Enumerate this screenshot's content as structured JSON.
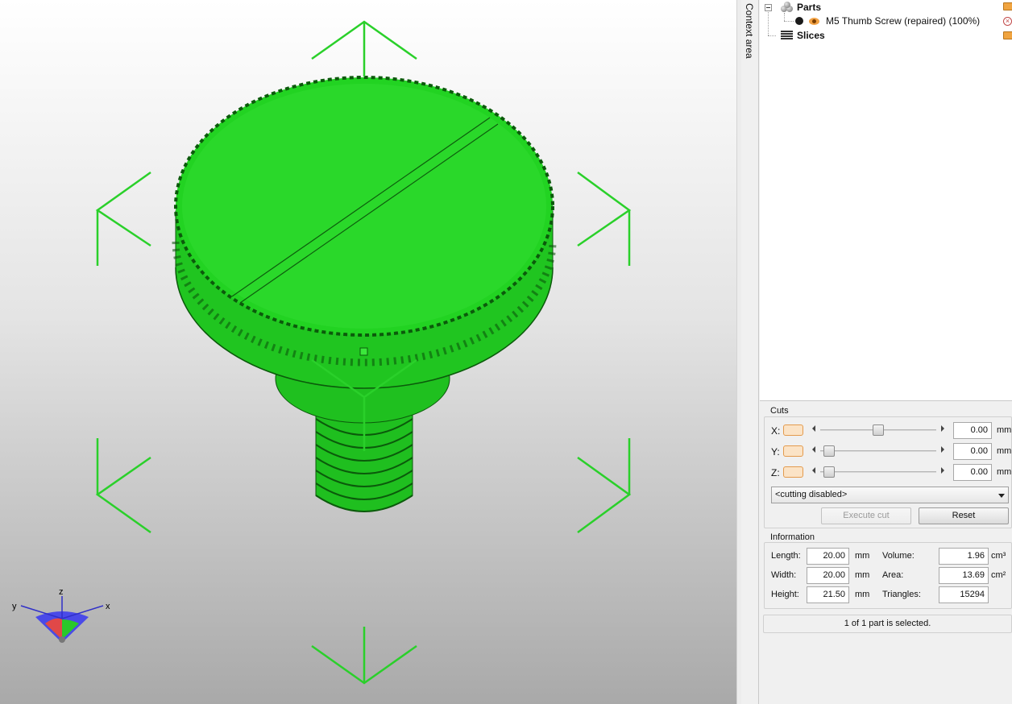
{
  "sidebar_tab": {
    "label": "Context area"
  },
  "tree": {
    "parts_label": "Parts",
    "part_item_label": "M5 Thumb Screw (repaired) (100%)",
    "slices_label": "Slices"
  },
  "cuts": {
    "title": "Cuts",
    "axes": [
      {
        "label": "X:",
        "value": "0.00",
        "unit": "mm",
        "slider_position": 0.5
      },
      {
        "label": "Y:",
        "value": "0.00",
        "unit": "mm",
        "slider_position": 0.0
      },
      {
        "label": "Z:",
        "value": "0.00",
        "unit": "mm",
        "slider_position": 0.0
      }
    ],
    "mode_selected": "<cutting disabled>",
    "execute_label": "Execute cut",
    "reset_label": "Reset"
  },
  "information": {
    "title": "Information",
    "length_label": "Length:",
    "length_value": "20.00",
    "length_unit": "mm",
    "width_label": "Width:",
    "width_value": "20.00",
    "width_unit": "mm",
    "height_label": "Height:",
    "height_value": "21.50",
    "height_unit": "mm",
    "volume_label": "Volume:",
    "volume_value": "1.96",
    "volume_unit": "cm³",
    "area_label": "Area:",
    "area_value": "13.69",
    "area_unit": "cm²",
    "triangles_label": "Triangles:",
    "triangles_value": "15294"
  },
  "status": {
    "text": "1 of 1 part is selected."
  },
  "axis_gizmo": {
    "x_label": "x",
    "y_label": "y",
    "z_label": "z"
  },
  "colors": {
    "model_green": "#2ad12a",
    "bracket_green": "#2ad02a",
    "accent_orange": "#e39a4d"
  }
}
